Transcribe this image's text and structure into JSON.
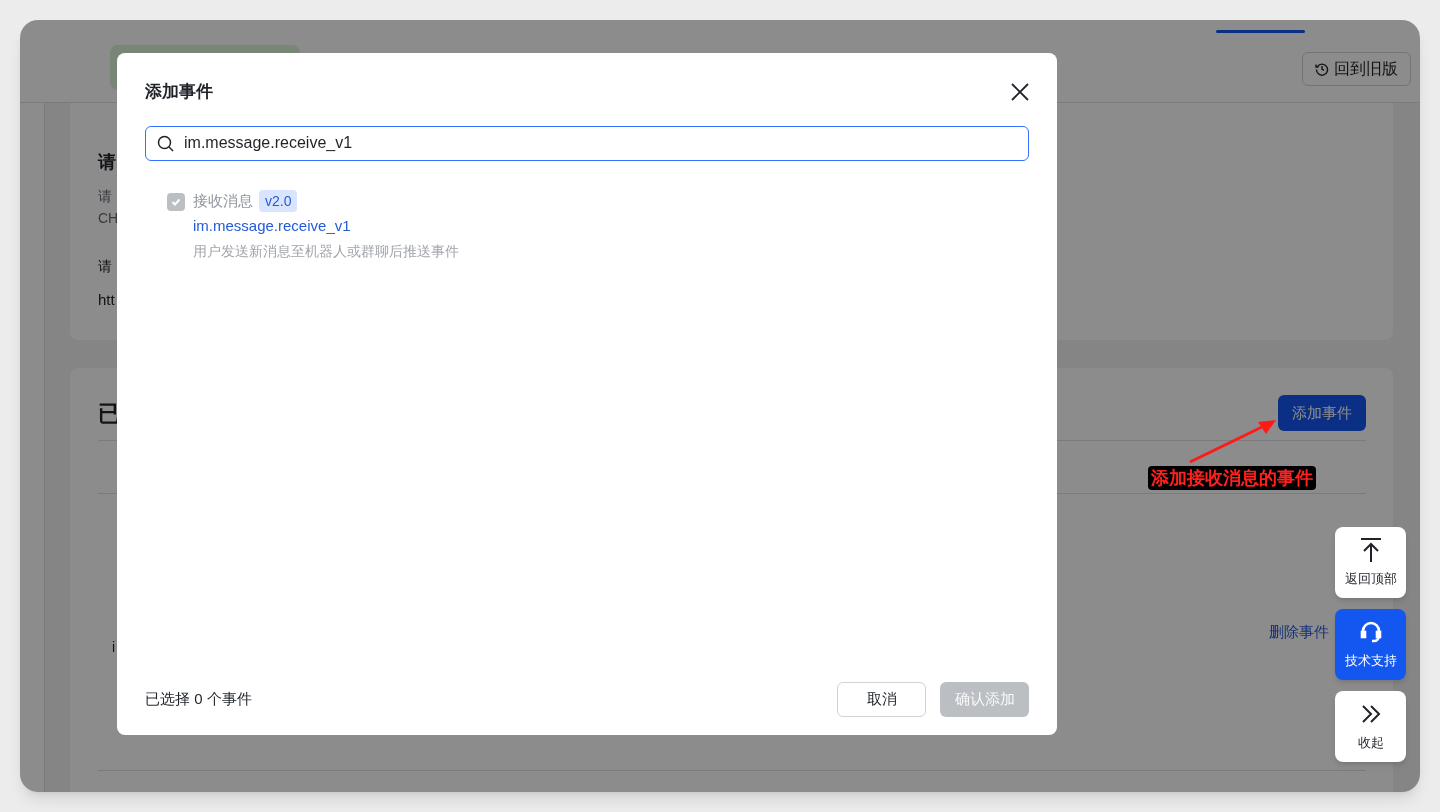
{
  "background_page": {
    "restore_button": "回到旧版",
    "section1_fragments": [
      {
        "kind": "heading",
        "text": "请"
      },
      {
        "kind": "text",
        "text": "请"
      },
      {
        "kind": "text",
        "text": "CH"
      },
      {
        "kind": "label",
        "text": "请"
      },
      {
        "kind": "value",
        "text": "htt"
      }
    ],
    "section2": {
      "title_fragment": "已",
      "add_button": "添加事件",
      "row_fragment": "i",
      "delete_link": "删除事件"
    }
  },
  "modal": {
    "title": "添加事件",
    "search": {
      "value": "im.message.receive_v1"
    },
    "events": [
      {
        "name": "接收消息",
        "version": "v2.0",
        "key": "im.message.receive_v1",
        "description": "用户发送新消息至机器人或群聊后推送事件",
        "checked": true,
        "disabled": true
      }
    ],
    "selected_count": "已选择 0 个事件",
    "buttons": [
      {
        "label": "取消",
        "kind": "secondary",
        "disabled": false
      },
      {
        "label": "确认添加",
        "kind": "primary",
        "disabled": true
      }
    ]
  },
  "annotation": {
    "text": "添加接收消息的事件"
  },
  "float_buttons": [
    {
      "label": "返回顶部",
      "kind": "top",
      "selected": false
    },
    {
      "label": "技术支持",
      "kind": "support",
      "selected": true
    },
    {
      "label": "收起",
      "kind": "collapse",
      "selected": false
    }
  ]
}
